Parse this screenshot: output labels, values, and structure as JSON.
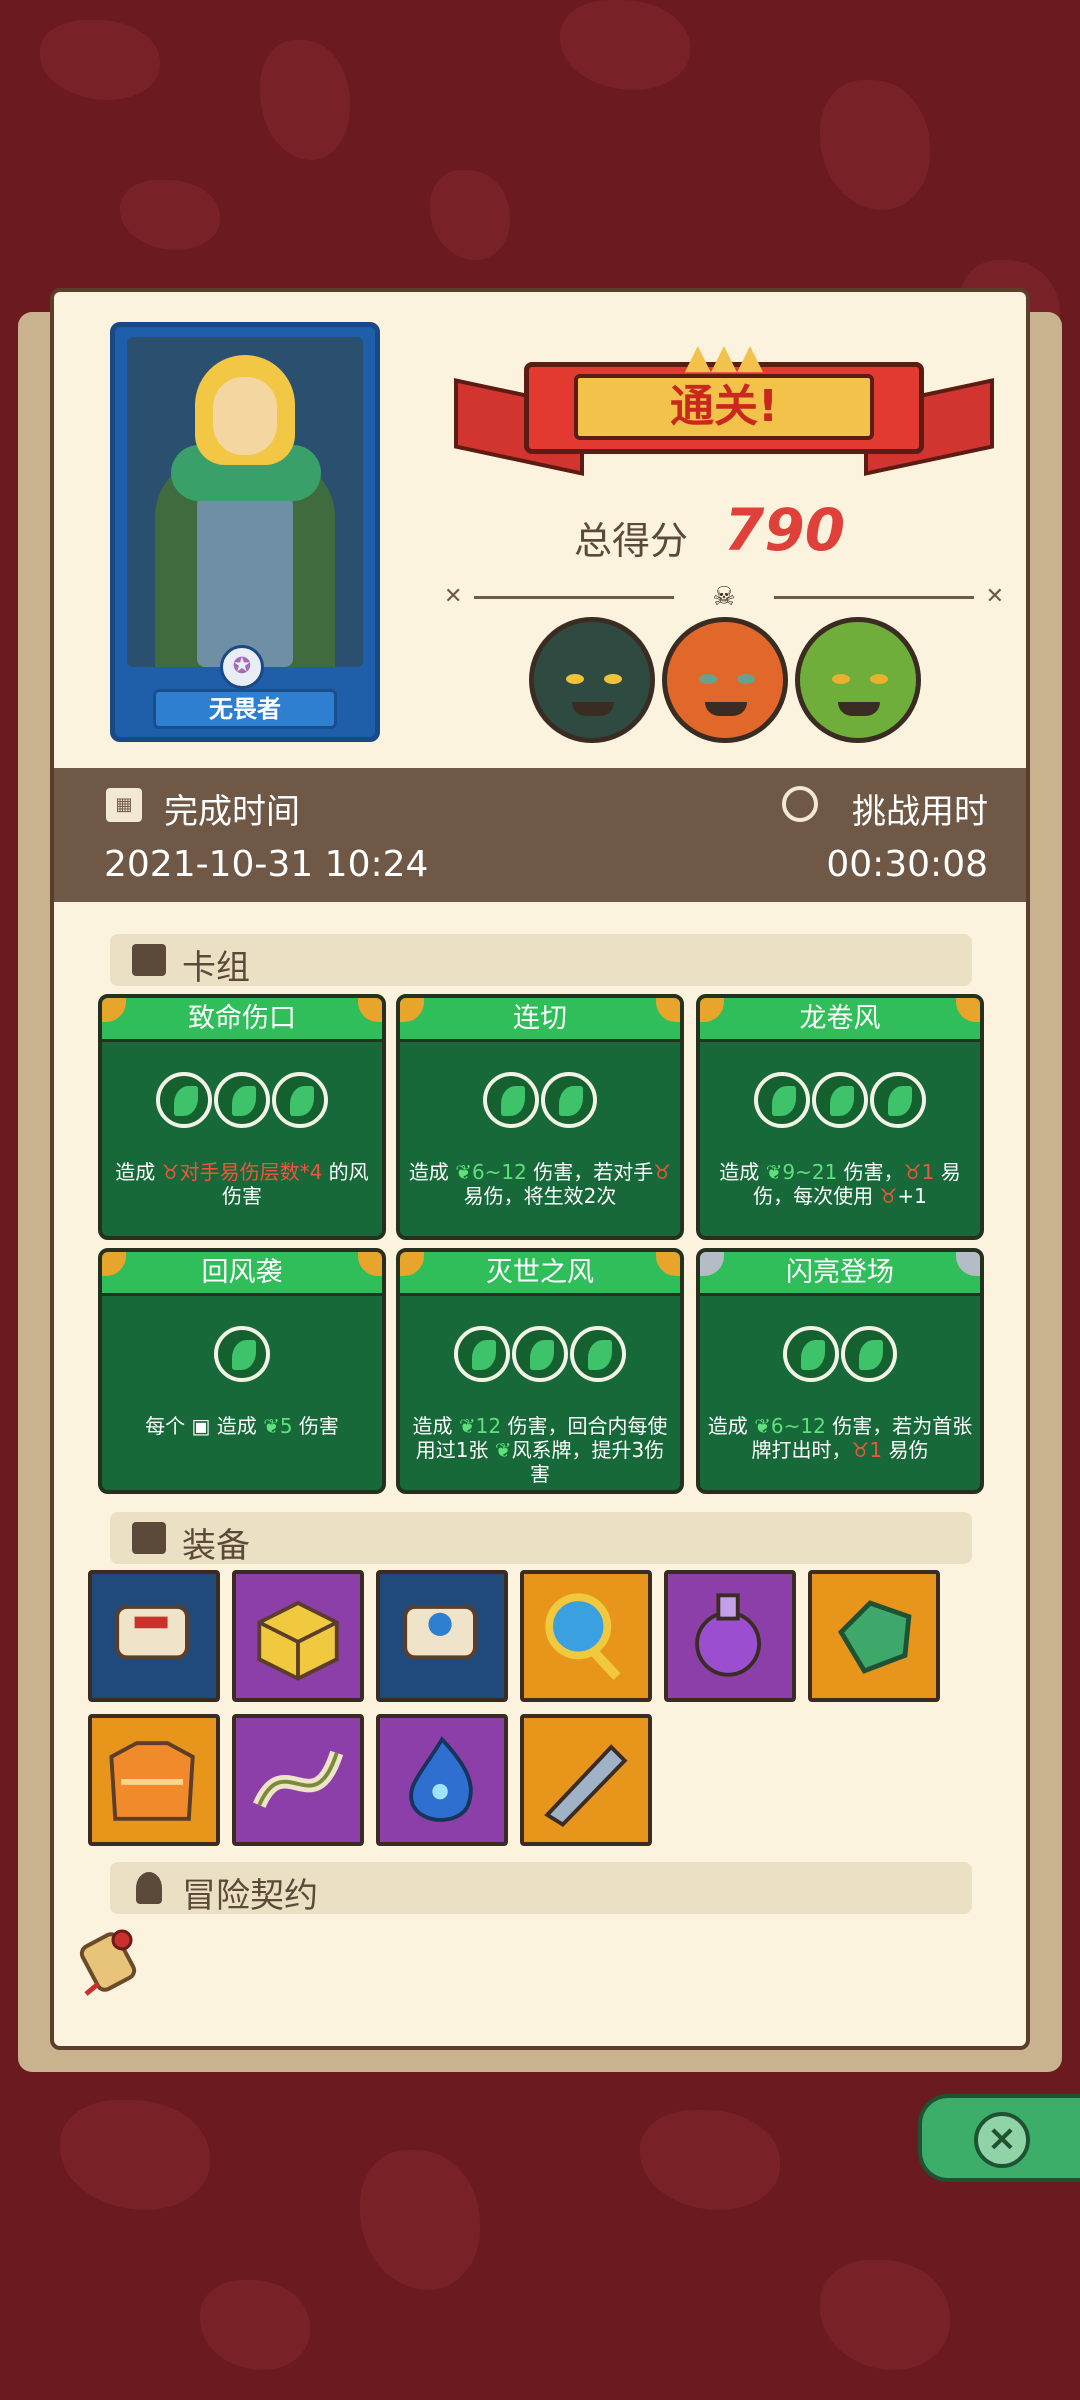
{
  "result": {
    "banner": "通关!",
    "score_label": "总得分",
    "score_value": "790"
  },
  "hero": {
    "name": "无畏者"
  },
  "bosses": [
    {
      "name": "armored-knight",
      "color": "#2f4a40",
      "accent": "#f1c23a"
    },
    {
      "name": "orange-ogre",
      "color": "#e2672b",
      "accent": "#6aa08e"
    },
    {
      "name": "golden-goblin-king",
      "color": "#6fae3a",
      "accent": "#e8b22f"
    }
  ],
  "time": {
    "finish_label": "完成时间",
    "finish_value": "2021-10-31 10:24",
    "challenge_label": "挑战用时",
    "challenge_value": "00:30:08"
  },
  "sections": {
    "deck": "卡组",
    "equipment": "装备",
    "contract": "冒险契约"
  },
  "cards": [
    {
      "title": "致命伤口",
      "orbs": 3,
      "corner": "gold",
      "desc": [
        "造成 ",
        {
          "t": "对手易伤层数*4",
          "c": "red",
          "icon": "bull"
        },
        " 的风伤害"
      ]
    },
    {
      "title": "连切",
      "orbs": 2,
      "corner": "gold",
      "desc": [
        "造成 ",
        {
          "t": "6~12",
          "c": "green",
          "icon": "leaf"
        },
        " 伤害，若对手",
        {
          "t": "",
          "c": "red",
          "icon": "bull"
        },
        "易伤，将生效2次"
      ]
    },
    {
      "title": "龙卷风",
      "orbs": 3,
      "corner": "gold",
      "desc": [
        "造成 ",
        {
          "t": "9~21",
          "c": "green",
          "icon": "leaf"
        },
        " 伤害，",
        {
          "t": "1",
          "c": "red",
          "icon": "bull"
        },
        " 易伤，每次使用 ",
        {
          "t": "",
          "c": "red",
          "icon": "bull"
        },
        "+1"
      ]
    },
    {
      "title": "回风袭",
      "orbs": 1,
      "corner": "gold",
      "desc": [
        "每个 ",
        {
          "t": "",
          "c": "white",
          "icon": "card"
        },
        " 造成 ",
        {
          "t": "5",
          "c": "green",
          "icon": "leaf"
        },
        " 伤害"
      ]
    },
    {
      "title": "灭世之风",
      "orbs": 3,
      "corner": "gold",
      "desc": [
        "造成 ",
        {
          "t": "12",
          "c": "green",
          "icon": "leaf"
        },
        " 伤害，回合内每使用过1张 ",
        {
          "t": "",
          "c": "green",
          "icon": "leaf"
        },
        "风系牌，提升3伤害"
      ]
    },
    {
      "title": "闪亮登场",
      "orbs": 2,
      "corner": "silver",
      "desc": [
        "造成 ",
        {
          "t": "6~12",
          "c": "green",
          "icon": "leaf"
        },
        " 伤害，若为首张牌打出时，",
        {
          "t": "1",
          "c": "red",
          "icon": "bull"
        },
        " 易伤"
      ]
    }
  ],
  "equipment": [
    {
      "name": "red-scroll",
      "bg": "#1f4a7a"
    },
    {
      "name": "golden-block",
      "bg": "#8c3fa8"
    },
    {
      "name": "snowflake-scroll",
      "bg": "#1f4a7a"
    },
    {
      "name": "blue-orb-amulet",
      "bg": "#e8951c"
    },
    {
      "name": "purple-potion",
      "bg": "#8c3fa8"
    },
    {
      "name": "green-gem",
      "bg": "#e8951c"
    },
    {
      "name": "orange-sweater",
      "bg": "#e8951c"
    },
    {
      "name": "tangled-vine",
      "bg": "#8c3fa8"
    },
    {
      "name": "blue-flame-spirit",
      "bg": "#8c3fa8"
    },
    {
      "name": "broken-blade",
      "bg": "#e8951c"
    }
  ]
}
